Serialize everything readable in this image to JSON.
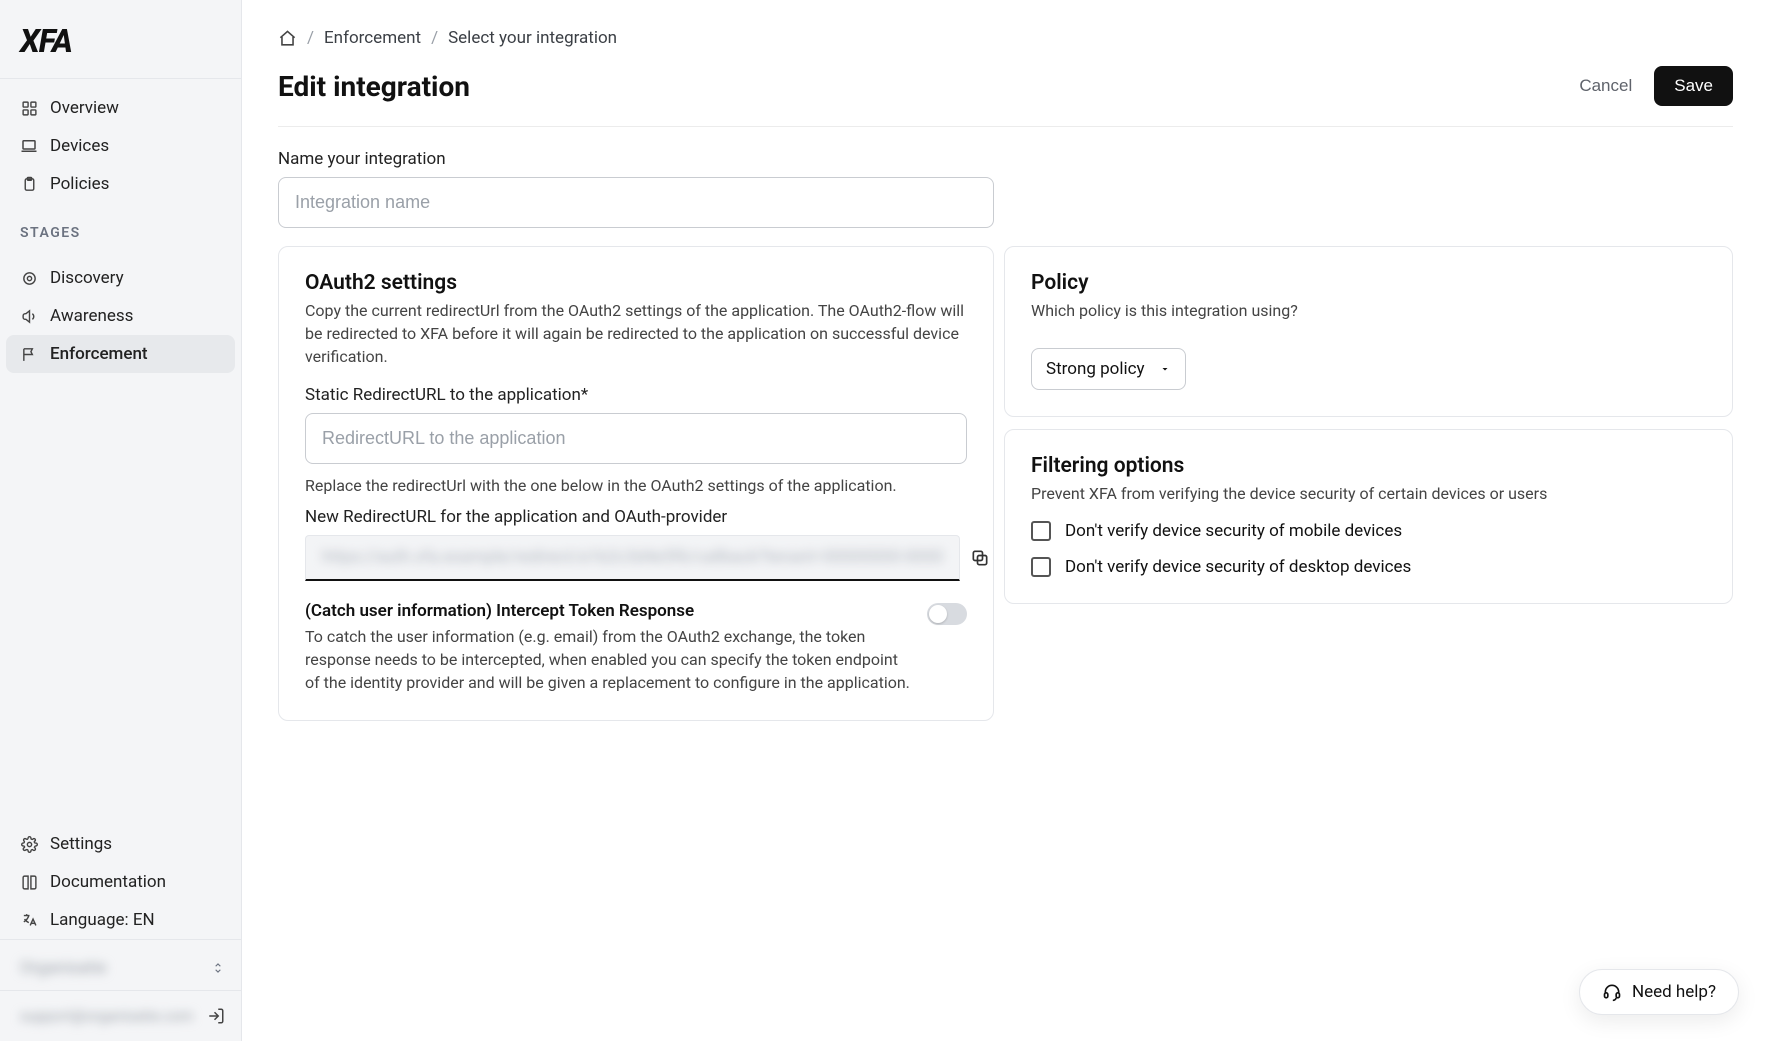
{
  "logo_text": "XFA",
  "sidebar": {
    "main_nav": [
      {
        "label": "Overview"
      },
      {
        "label": "Devices"
      },
      {
        "label": "Policies"
      }
    ],
    "stages_heading": "STAGES",
    "stages": [
      {
        "label": "Discovery"
      },
      {
        "label": "Awareness"
      },
      {
        "label": "Enforcement"
      }
    ],
    "bottom": [
      {
        "label": "Settings"
      },
      {
        "label": "Documentation"
      },
      {
        "label": "Language: EN"
      }
    ],
    "org_label": "Organisatie",
    "user_label": "support@organisatie.com"
  },
  "breadcrumb": {
    "enforcement": "Enforcement",
    "select": "Select your integration"
  },
  "page": {
    "title": "Edit integration",
    "cancel": "Cancel",
    "save": "Save"
  },
  "name_field": {
    "label": "Name your integration",
    "placeholder": "Integration name",
    "value": ""
  },
  "oauth": {
    "title": "OAuth2 settings",
    "desc": "Copy the current redirectUrl from the OAuth2 settings of the application. The OAuth2-flow will be redirected to XFA before it will again be redirected to the application on successful device verification.",
    "static_label": "Static RedirectURL to the application*",
    "static_placeholder": "RedirectURL to the application",
    "static_value": "",
    "replace_note": "Replace the redirectUrl with the one below in the OAuth2 settings of the application.",
    "new_label": "New RedirectURL for the application and OAuth-provider",
    "new_value_masked": "https://auth.xfa.example/redirect/a1b2c3d4e5f6/callback?tenant=00000000-0000",
    "toggle_title": "(Catch user information) Intercept Token Response",
    "toggle_desc": "To catch the user information (e.g. email) from the OAuth2 exchange, the token response needs to be intercepted, when enabled you can specify the token endpoint of the identity provider and will be given a replacement to configure in the application.",
    "toggle_on": false
  },
  "policy": {
    "title": "Policy",
    "desc": "Which policy is this integration using?",
    "selected": "Strong policy"
  },
  "filtering": {
    "title": "Filtering options",
    "desc": "Prevent XFA from verifying the device security of certain devices or users",
    "opt_mobile": "Don't verify device security of mobile devices",
    "opt_desktop": "Don't verify device security of desktop devices"
  },
  "help": {
    "label": "Need help?"
  }
}
